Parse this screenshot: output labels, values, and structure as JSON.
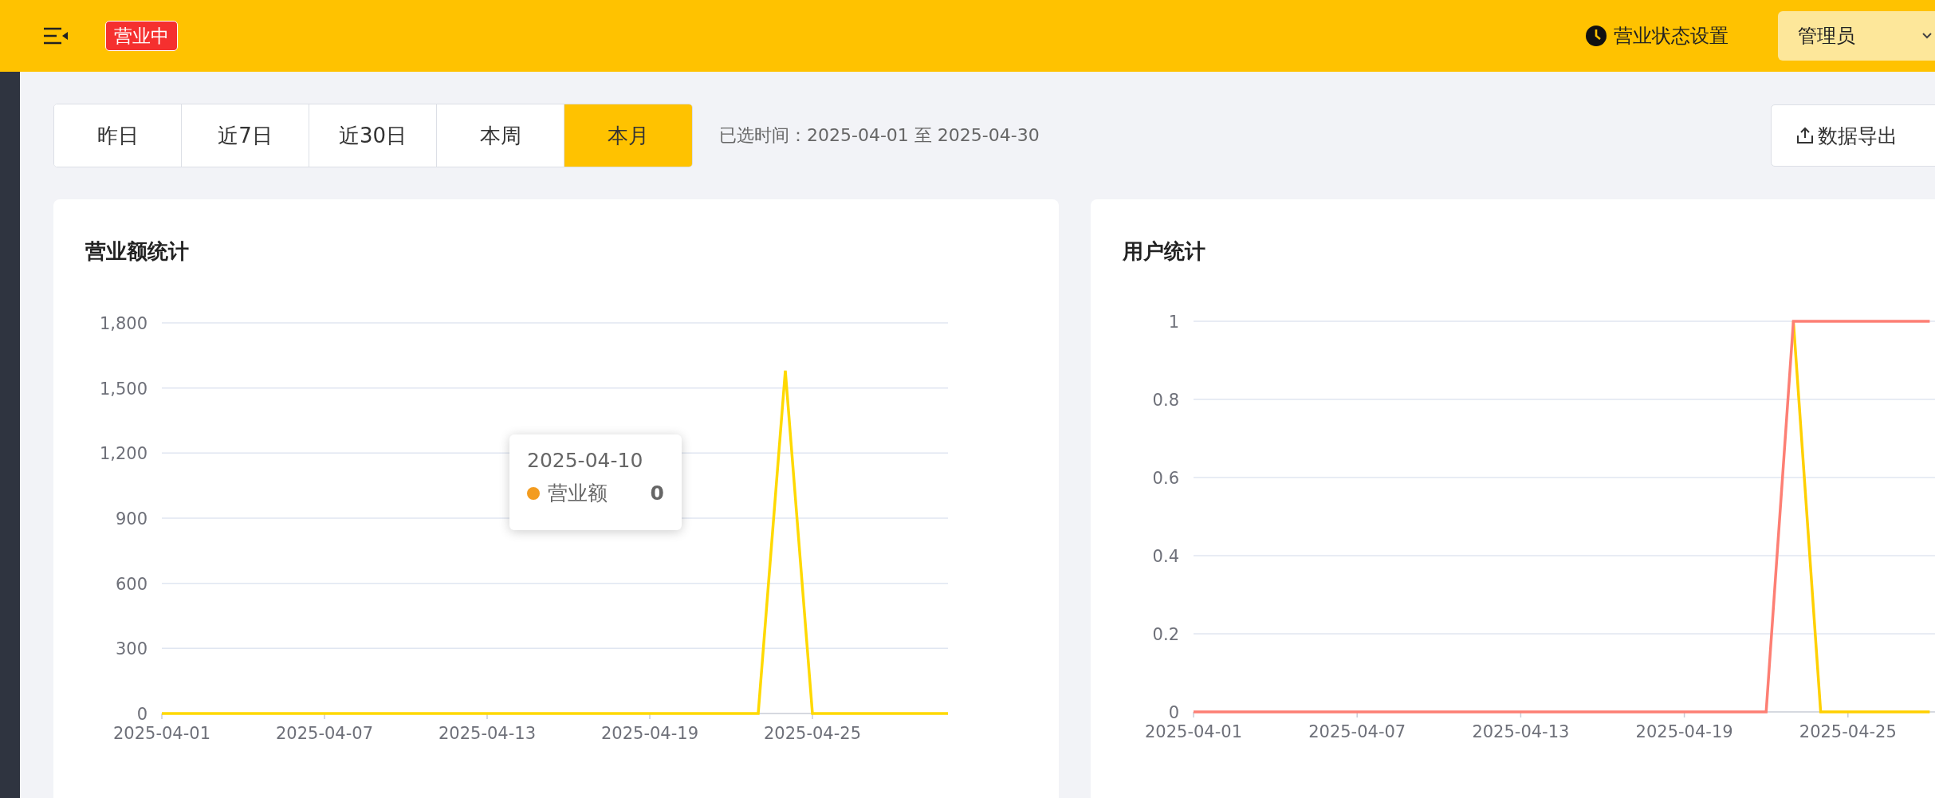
{
  "header": {
    "status_badge": "营业中",
    "status_settings": "营业状态设置",
    "user_menu": "管理员"
  },
  "toolbar": {
    "tabs": [
      {
        "label": "昨日",
        "selected": false
      },
      {
        "label": "近7日",
        "selected": false
      },
      {
        "label": "近30日",
        "selected": false
      },
      {
        "label": "本周",
        "selected": false
      },
      {
        "label": "本月",
        "selected": true
      }
    ],
    "selected_range": "已选时间：2025-04-01 至 2025-04-30",
    "export_button": "数据导出"
  },
  "cards": [
    {
      "title": "营业额统计",
      "chart_data": {
        "type": "line",
        "grid": true,
        "categories": [
          "2025-04-01",
          null,
          null,
          null,
          null,
          null,
          "2025-04-07",
          null,
          null,
          null,
          null,
          null,
          "2025-04-13",
          null,
          null,
          null,
          null,
          null,
          "2025-04-19",
          null,
          null,
          null,
          null,
          null,
          "2025-04-25",
          null,
          null,
          null,
          null,
          null
        ],
        "series": [
          {
            "name": "营业额",
            "color": "#ffd900",
            "values": [
              0,
              0,
              0,
              0,
              0,
              0,
              0,
              0,
              0,
              0,
              0,
              0,
              0,
              0,
              0,
              0,
              0,
              0,
              0,
              0,
              0,
              0,
              0,
              1580,
              0,
              0,
              0,
              0,
              0,
              0
            ]
          }
        ],
        "ylim": [
          0,
          1800
        ],
        "yticks": [
          0,
          300,
          600,
          900,
          {
            "value": 1200,
            "label": "1,200"
          },
          {
            "value": 1500,
            "label": "1,500"
          },
          {
            "value": 1800,
            "label": "1,800"
          }
        ]
      },
      "tooltip": {
        "date": "2025-04-10",
        "value": "0",
        "color": "#f39c1f"
      }
    },
    {
      "title": "用户统计",
      "chart_data": {
        "type": "line",
        "grid": true,
        "categories": [
          "2025-04-01",
          null,
          null,
          null,
          null,
          null,
          "2025-04-07",
          null,
          null,
          null,
          null,
          null,
          "2025-04-13",
          null,
          null,
          null,
          null,
          null,
          "2025-04-19",
          null,
          null,
          null,
          null,
          null,
          "2025-04-25",
          null,
          null,
          null
        ],
        "series": [
          {
            "color": "#ffd000",
            "values": [
              null,
              null,
              null,
              null,
              null,
              null,
              null,
              null,
              null,
              null,
              null,
              null,
              null,
              null,
              null,
              null,
              null,
              null,
              null,
              null,
              null,
              null,
              1,
              0,
              0,
              0,
              0,
              0
            ]
          },
          {
            "color": "#fd7f74",
            "values": [
              0,
              0,
              0,
              0,
              0,
              0,
              0,
              0,
              0,
              0,
              0,
              0,
              0,
              0,
              0,
              0,
              0,
              0,
              0,
              0,
              0,
              0,
              1,
              1,
              1,
              1,
              1,
              1
            ]
          }
        ],
        "ylim": [
          0,
          1
        ],
        "yticks": [
          0,
          0.2,
          0.4,
          0.6,
          0.8,
          1
        ]
      }
    }
  ]
}
